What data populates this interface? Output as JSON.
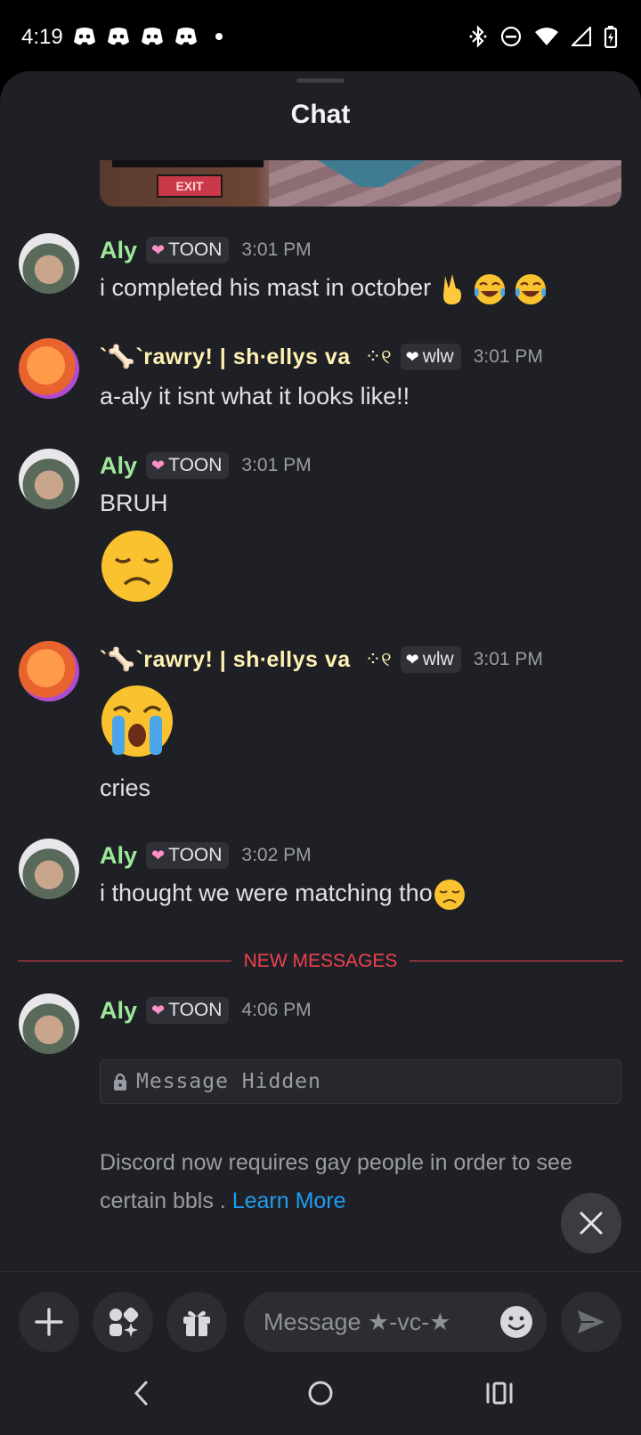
{
  "status_bar": {
    "time": "4:19"
  },
  "header": {
    "title": "Chat"
  },
  "image_attachment": {
    "sign_text": "EXIT"
  },
  "messages": [
    {
      "author": "Aly",
      "tag": "TOON",
      "time": "3:01 PM",
      "text": "i completed his mast in october"
    },
    {
      "author": "`🦴`rawry! | sh∙ellys va",
      "tag": "wlw",
      "time": "3:01 PM",
      "text": "a-aly it isnt what it looks like!!"
    },
    {
      "author": "Aly",
      "tag": "TOON",
      "time": "3:01 PM",
      "text": "BRUH"
    },
    {
      "author": "`🦴`rawry! | sh∙ellys va",
      "tag": "wlw",
      "time": "3:01 PM",
      "text": "cries"
    },
    {
      "author": "Aly",
      "tag": "TOON",
      "time": "3:02 PM",
      "text": "i thought we were matching tho"
    },
    {
      "author": "Aly",
      "tag": "TOON",
      "time": "4:06 PM",
      "hidden_text": "Message Hidden"
    }
  ],
  "divider": {
    "label": "NEW MESSAGES"
  },
  "notice": {
    "text": "Discord now requires gay people in order to see certain bbls . ",
    "link": "Learn More"
  },
  "composer": {
    "placeholder": "Message ★-vc-★"
  },
  "colors": {
    "aly_name": "#9ee89a",
    "rawry_name": "#fff2b3",
    "new_messages": "#f0414e",
    "link": "#1e9cf0",
    "background": "#1f2025"
  },
  "icons": [
    "discord-icon",
    "bluetooth-icon",
    "dnd-icon",
    "wifi-icon",
    "signal-icon",
    "battery-icon",
    "heart-icon",
    "lock-icon",
    "close-icon",
    "plus-icon",
    "apps-icon",
    "gift-icon",
    "emoji-icon",
    "send-icon",
    "back-icon",
    "home-icon",
    "recents-icon"
  ]
}
